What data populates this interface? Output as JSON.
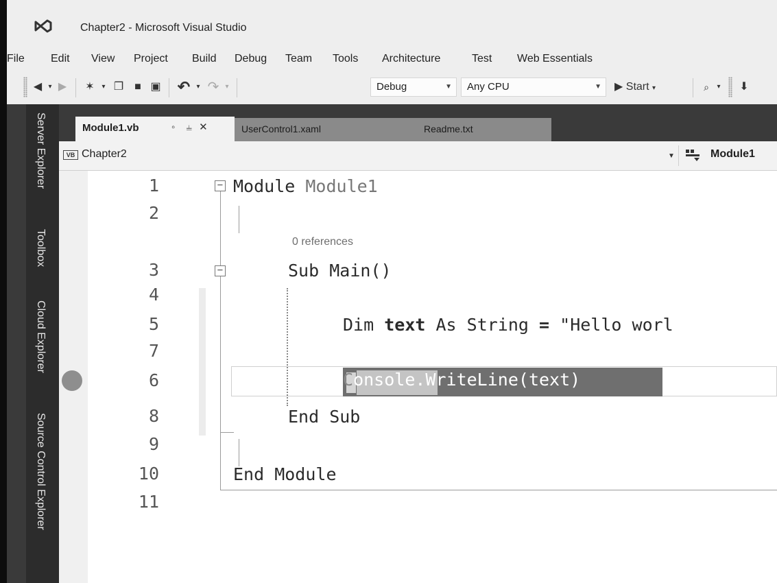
{
  "window": {
    "title": "Chapter2 - Microsoft Visual Studio",
    "logo_icon": "visual-studio-icon"
  },
  "menu": [
    "File",
    "Edit",
    "View",
    "Project",
    "Build",
    "Debug",
    "Team",
    "Tools",
    "Architecture",
    "Test",
    "Web Essentials"
  ],
  "toolbar": {
    "configuration": "Debug",
    "platform": "Any CPU",
    "start_label": "Start",
    "icons": [
      "back-icon",
      "forward-icon",
      "new-project-icon",
      "open-file-icon",
      "save-icon",
      "save-all-icon",
      "undo-icon",
      "redo-icon",
      "start-icon",
      "find-icon"
    ]
  },
  "dock_tabs": [
    "Server Explorer",
    "Toolbox",
    "Cloud Explorer",
    "Source Control Explorer"
  ],
  "tabs": [
    {
      "label": "Module1.vb",
      "active": true
    },
    {
      "label": "UserControl1.xaml",
      "active": false
    },
    {
      "label": "Readme.txt",
      "active": false
    }
  ],
  "navbar": {
    "project_icon": "VB",
    "project": "Chapter2",
    "member": "Module1"
  },
  "editor": {
    "line_numbers": [
      "1",
      "2",
      "3",
      "4",
      "5",
      "6",
      "7",
      "8",
      "9",
      "10",
      "11"
    ],
    "codelens": "0 references",
    "lines": {
      "l1_kw": "Module",
      "l1_name": "Module1",
      "l3_kw": "Sub",
      "l3_name": "Main()",
      "l5_dim": "Dim",
      "l5_var": "text",
      "l5_as": "As String",
      "l5_eq": "=",
      "l5_str": "\"Hello worl",
      "l6_c": "C",
      "l6_console": "onsole",
      "l6_rest": ".WriteLine(text)",
      "l8": "End Sub",
      "l10": "End Module"
    },
    "breakpoint_line": 6
  },
  "colors": {
    "dock": "#3a3a3a",
    "chrome": "#eeeeee",
    "selection": "#6f6f6f",
    "breakpoint": "#8e8e8e"
  }
}
